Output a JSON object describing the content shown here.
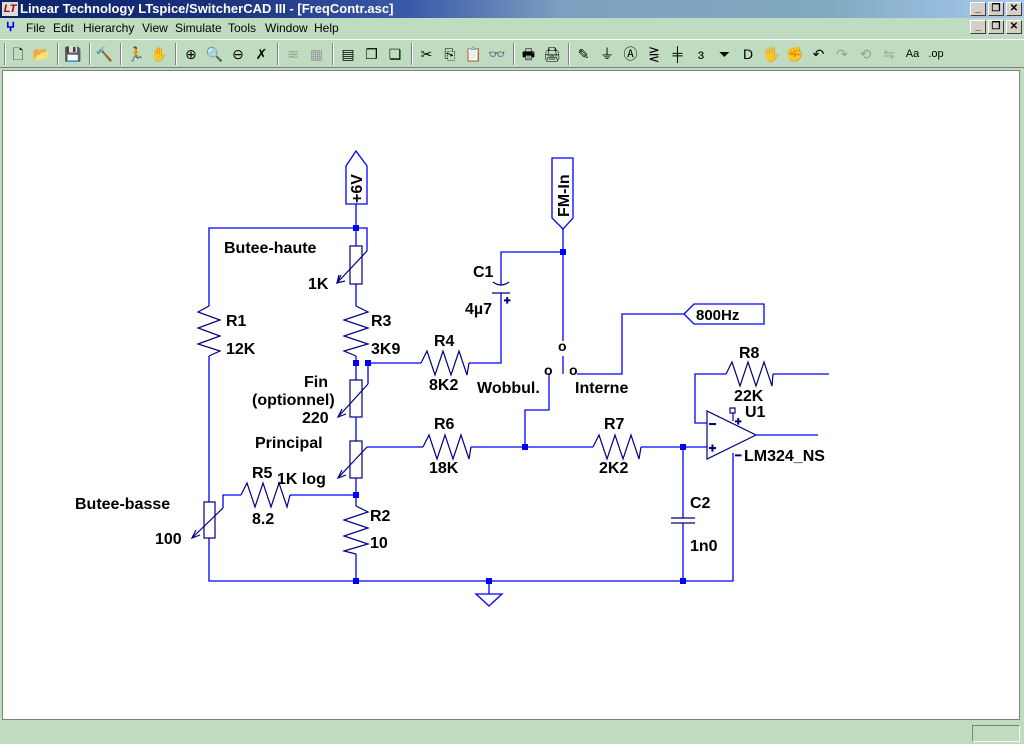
{
  "window": {
    "title": "Linear Technology LTspice/SwitcherCAD III - [FreqContr.asc]",
    "logo": "LT"
  },
  "menu": [
    "File",
    "Edit",
    "Hierarchy",
    "View",
    "Simulate",
    "Tools",
    "Window",
    "Help"
  ],
  "toolbar": [
    {
      "name": "new-schematic-icon",
      "glyph": "🗋"
    },
    {
      "name": "open-icon",
      "glyph": "📂"
    },
    {
      "sep": true
    },
    {
      "name": "save-icon",
      "glyph": "💾"
    },
    {
      "sep": true
    },
    {
      "name": "control-panel-hammer-icon",
      "glyph": "🔨"
    },
    {
      "sep": true
    },
    {
      "name": "run-icon",
      "glyph": "🏃"
    },
    {
      "name": "halt-hand-icon",
      "glyph": "✋",
      "disabled": true
    },
    {
      "sep": true
    },
    {
      "name": "zoom-in-icon",
      "glyph": "⊕"
    },
    {
      "name": "pan-zoom-icon",
      "glyph": "🔍",
      "disabled": true
    },
    {
      "name": "zoom-out-icon",
      "glyph": "⊖"
    },
    {
      "name": "zoom-fit-icon",
      "glyph": "✗"
    },
    {
      "sep": true
    },
    {
      "name": "autorange-icon",
      "glyph": "≋",
      "disabled": true
    },
    {
      "name": "grid-icon",
      "glyph": "▦",
      "disabled": true
    },
    {
      "sep": true
    },
    {
      "name": "tile-horizontal-icon",
      "glyph": "▤"
    },
    {
      "name": "cascade-icon",
      "glyph": "❐"
    },
    {
      "name": "close-window-icon",
      "glyph": "❏"
    },
    {
      "sep": true
    },
    {
      "name": "cut-icon",
      "glyph": "✂"
    },
    {
      "name": "copy-icon",
      "glyph": "⎘"
    },
    {
      "name": "paste-icon",
      "glyph": "📋",
      "disabled": true
    },
    {
      "name": "find-icon",
      "glyph": "👓"
    },
    {
      "sep": true
    },
    {
      "name": "print-preview-icon",
      "glyph": "🖶"
    },
    {
      "name": "print-icon",
      "glyph": "🖨"
    },
    {
      "sep": true
    },
    {
      "name": "draw-wire-icon",
      "glyph": "✎"
    },
    {
      "name": "ground-icon",
      "glyph": "⏚"
    },
    {
      "name": "label-net-icon",
      "glyph": "Ⓐ"
    },
    {
      "name": "resistor-icon",
      "glyph": "⋛"
    },
    {
      "name": "capacitor-icon",
      "glyph": "╪"
    },
    {
      "name": "inductor-icon",
      "glyph": "ɜ"
    },
    {
      "name": "diode-icon",
      "glyph": "⏷"
    },
    {
      "name": "component-icon",
      "glyph": "D"
    },
    {
      "name": "move-icon",
      "glyph": "🖐"
    },
    {
      "name": "drag-icon",
      "glyph": "✊"
    },
    {
      "name": "undo-icon",
      "glyph": "↶"
    },
    {
      "name": "redo-icon",
      "glyph": "↷",
      "disabled": true
    },
    {
      "name": "rotate-icon",
      "glyph": "⟲",
      "disabled": true
    },
    {
      "name": "mirror-icon",
      "glyph": "⇋",
      "disabled": true
    },
    {
      "name": "text-icon",
      "glyph": "Aa"
    },
    {
      "name": "spice-directive-icon",
      "glyph": ".op"
    }
  ],
  "schematic": {
    "flags": {
      "vcc": "+6V",
      "fm_in": "FM-In",
      "freq": "800Hz"
    },
    "labels": {
      "butee_haute": "Butee-haute",
      "butee_haute_val": "1K",
      "r1": "R1",
      "r1_val": "12K",
      "r3": "R3",
      "r3_val": "3K9",
      "r4": "R4",
      "r4_val": "8K2",
      "c1": "C1",
      "c1_val": "4µ7",
      "fin": "Fin",
      "fin2": "(optionnel)",
      "fin_val": "220",
      "principal": "Principal",
      "principal_val": "1K log",
      "r5": "R5",
      "r5_val": "8.2",
      "butee_basse": "Butee-basse",
      "butee_basse_val": "100",
      "r2": "R2",
      "r2_val": "10",
      "r6": "R6",
      "r6_val": "18K",
      "r7": "R7",
      "r7_val": "2K2",
      "c2": "C2",
      "c2_val": "1n0",
      "r8": "R8",
      "r8_val": "22K",
      "u1": "U1",
      "u1_val": "LM324_NS",
      "wobbul": "Wobbul.",
      "interne": "Interne",
      "sw_o": "o"
    },
    "colors": {
      "wire": "#0000ff",
      "component": "#000080"
    }
  }
}
